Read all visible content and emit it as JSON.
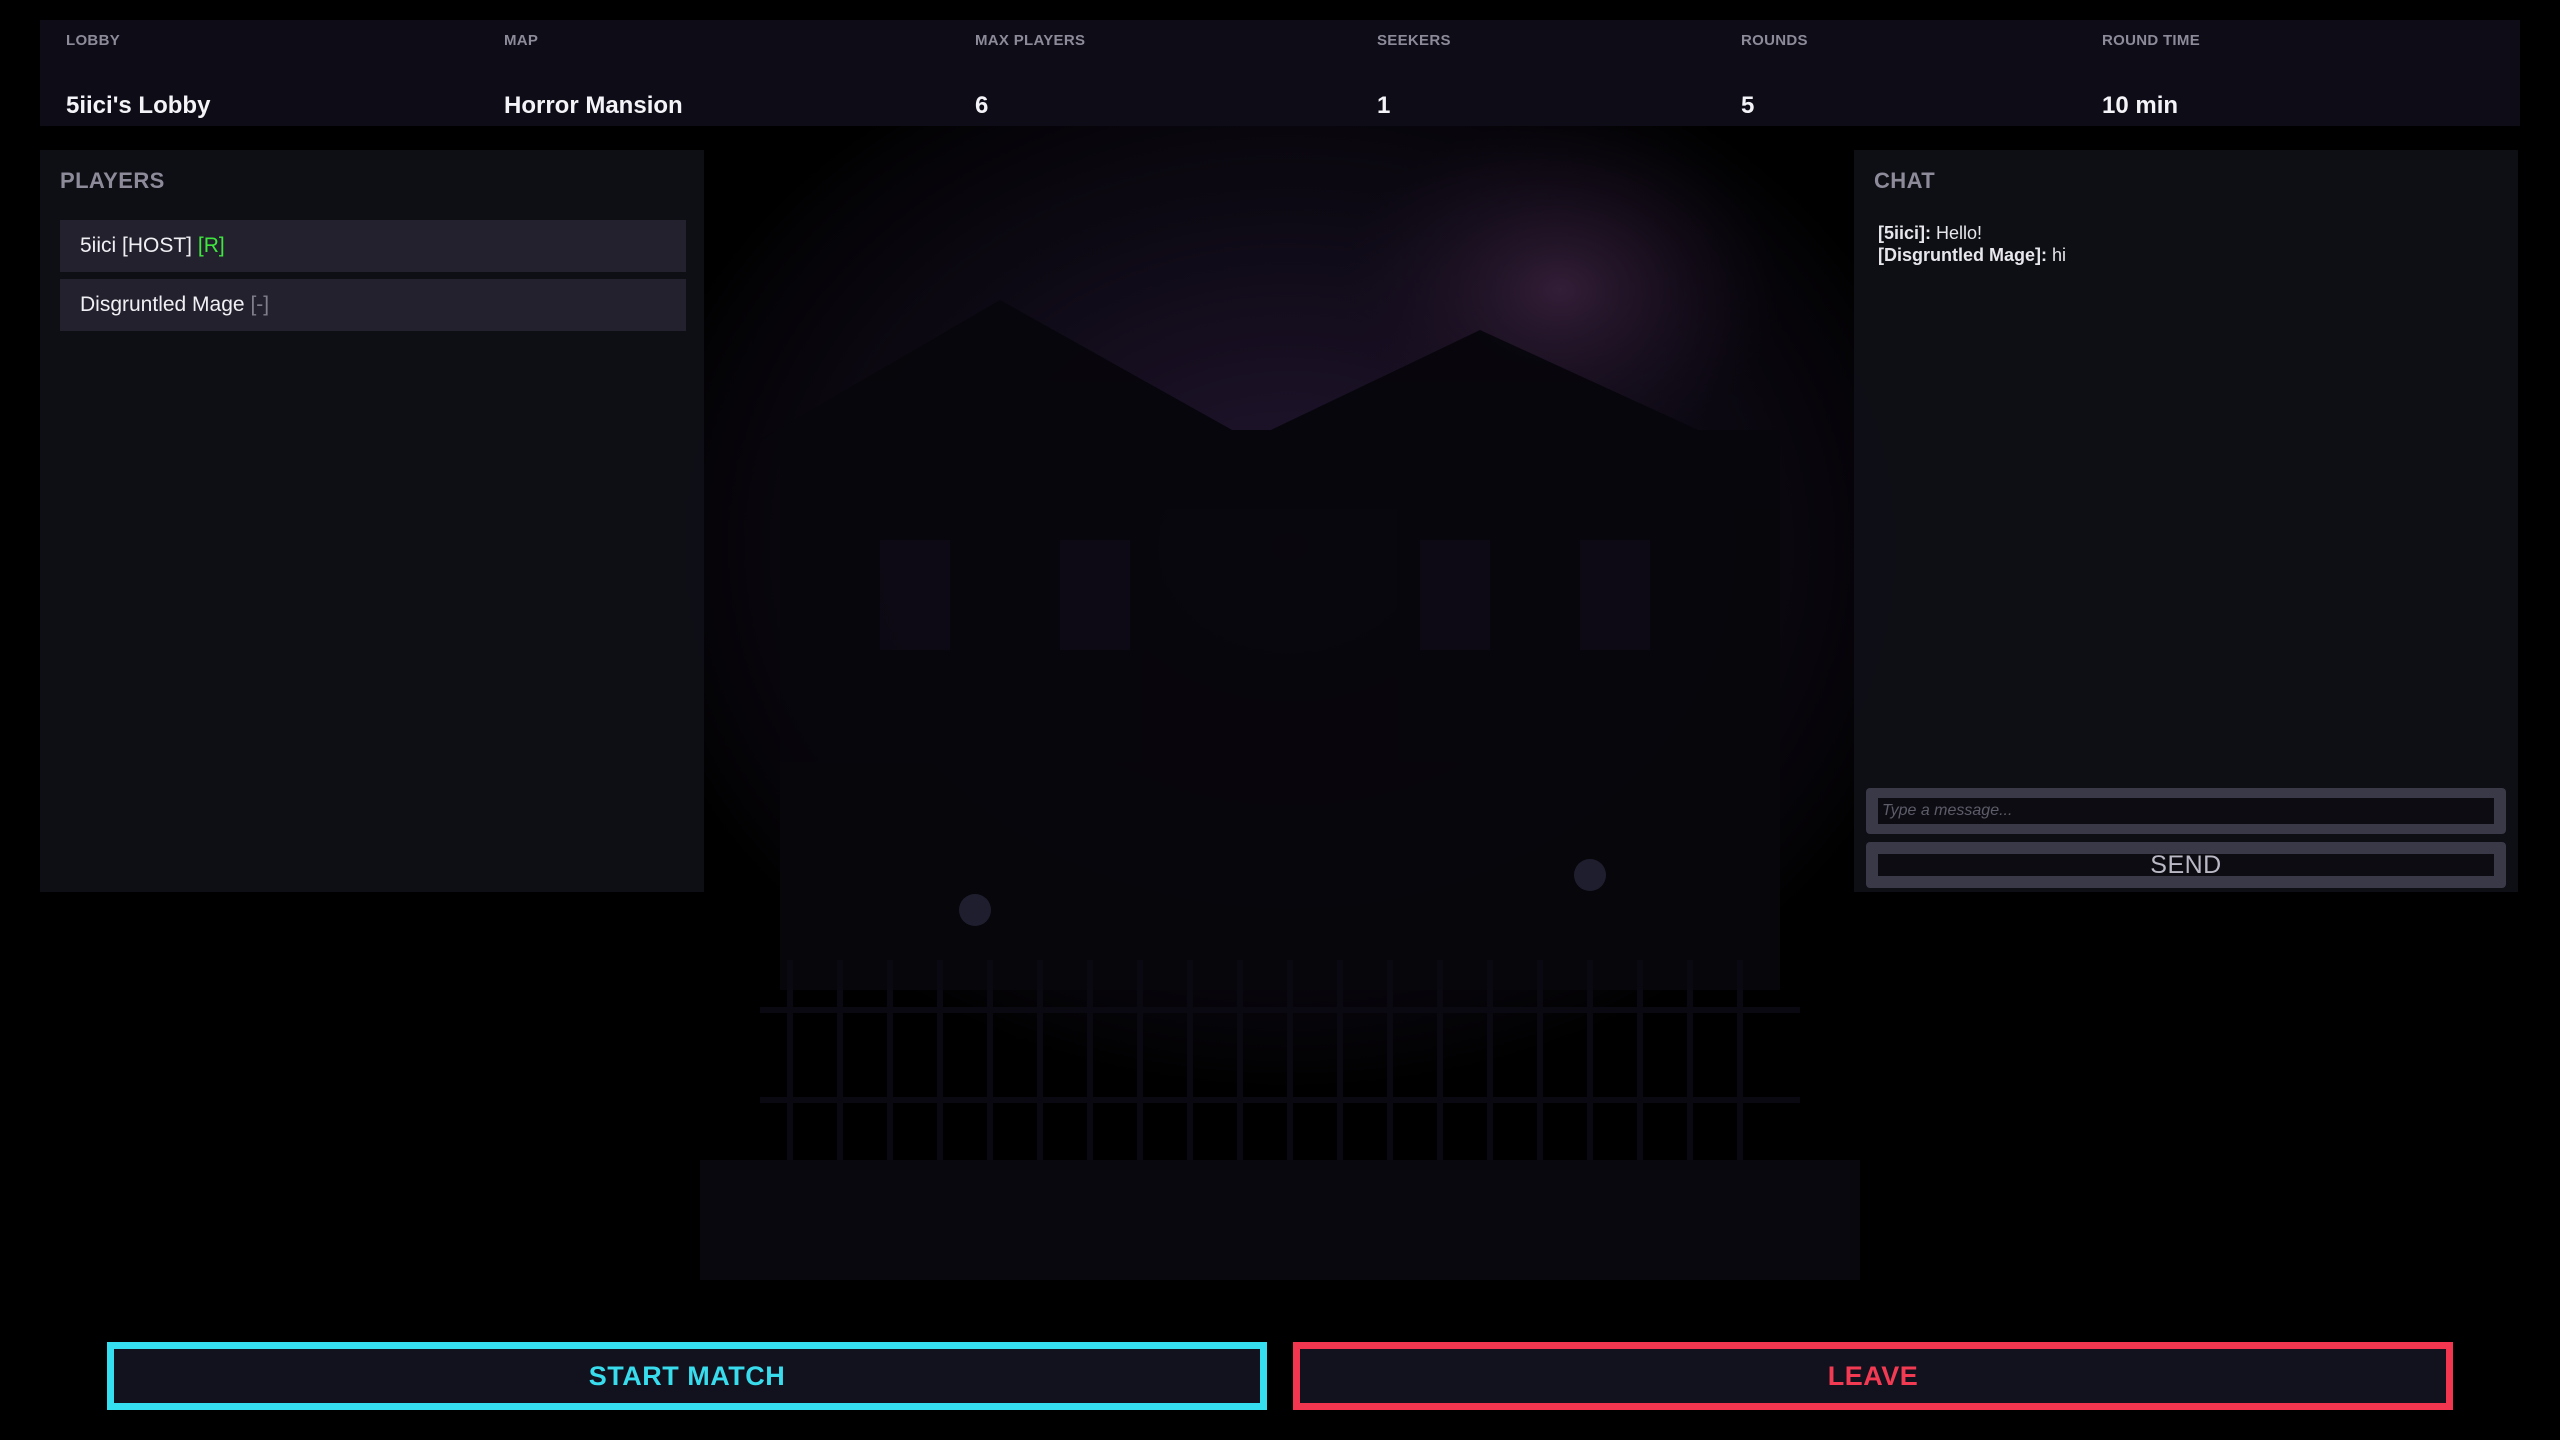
{
  "info_bar": {
    "columns": [
      {
        "label": "LOBBY",
        "value": "5iici's Lobby"
      },
      {
        "label": "MAP",
        "value": "Horror Mansion"
      },
      {
        "label": "MAX PLAYERS",
        "value": "6"
      },
      {
        "label": "SEEKERS",
        "value": "1"
      },
      {
        "label": "ROUNDS",
        "value": "5"
      },
      {
        "label": "ROUND TIME",
        "value": "10 min"
      }
    ]
  },
  "players_panel": {
    "title": "PLAYERS",
    "players": [
      {
        "name": "5iici [HOST]",
        "tag": "[R]"
      },
      {
        "name": "Disgruntled Mage",
        "tag": "[-]"
      }
    ]
  },
  "chat_panel": {
    "title": "CHAT",
    "messages": [
      {
        "author": "[5iici]:",
        "text": "Hello!"
      },
      {
        "author": "[Disgruntled Mage]:",
        "text": "hi"
      }
    ],
    "input_placeholder": "Type a message...",
    "send_label": "SEND"
  },
  "actions": {
    "start_label": "START MATCH",
    "leave_label": "LEAVE"
  },
  "colors": {
    "start_accent": "#35dff0",
    "leave_accent": "#f2364f",
    "ready_tag": "#3ee63e"
  }
}
